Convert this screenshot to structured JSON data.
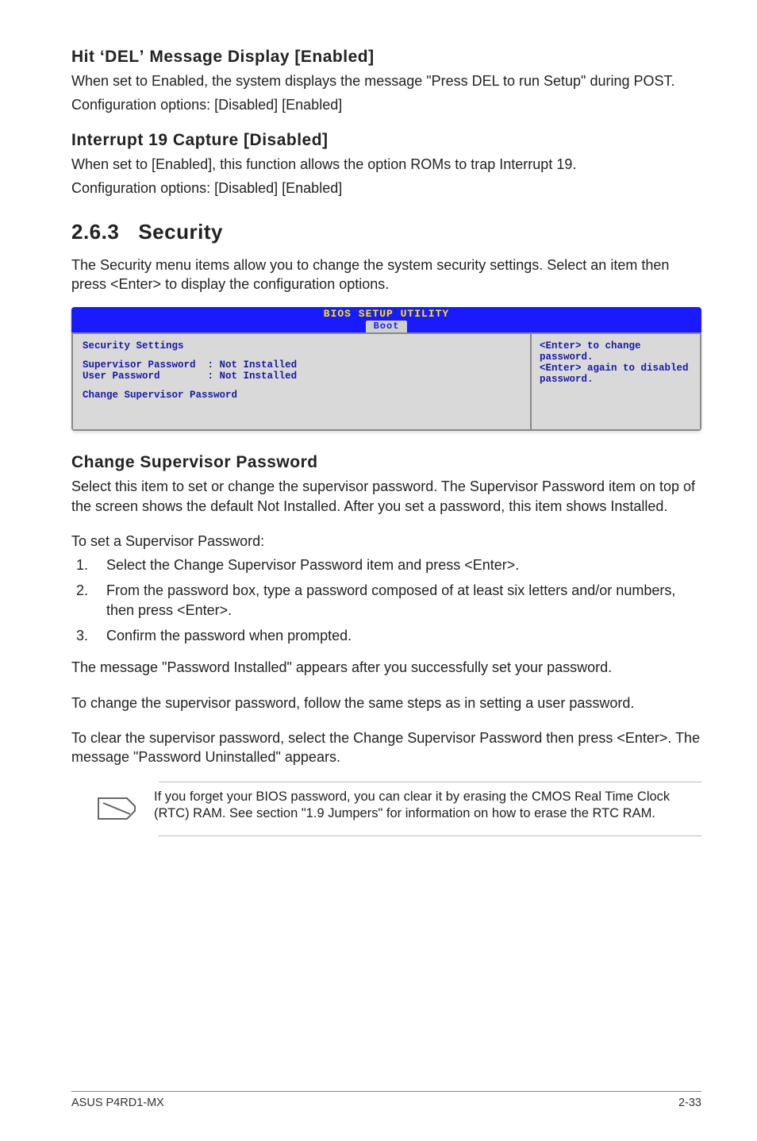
{
  "sec1": {
    "title": "Hit ʻDELʼ Message Display [Enabled]",
    "p1": "When set to Enabled, the system displays the message \"Press DEL to run Setup\" during POST.",
    "p2": "Configuration options: [Disabled] [Enabled]"
  },
  "sec2": {
    "title": "Interrupt 19 Capture [Disabled]",
    "p1": "When set to [Enabled], this function allows the option ROMs to trap Interrupt 19.",
    "p2": "Configuration options: [Disabled] [Enabled]"
  },
  "sec3": {
    "num": "2.6.3",
    "title": "Security",
    "intro": "The Security menu items allow you to change the system security settings. Select an item then press <Enter> to display the configuration options."
  },
  "bios": {
    "header": "BIOS SETUP UTILITY",
    "tab": "Boot",
    "left_title": "Security Settings",
    "row1_label": "Supervisor Password",
    "row1_value": ": Not Installed",
    "row2_label": "User Password",
    "row2_value": ": Not Installed",
    "row3": "Change Supervisor Password",
    "right1": "<Enter> to change password.",
    "right2": "<Enter> again to disabled password."
  },
  "sec4": {
    "title": "Change Supervisor Password",
    "p1": "Select this item to set or change the supervisor password. The Supervisor Password item on top of the screen shows the default Not Installed. After you set a password, this item shows Installed.",
    "p2": "To set a Supervisor Password:",
    "steps": [
      "Select the Change Supervisor Password item and press <Enter>.",
      "From the password box, type a password composed of at least six letters and/or numbers, then press <Enter>.",
      "Confirm the password when prompted."
    ],
    "p3": "The message \"Password Installed\" appears after you successfully set your password.",
    "p4": "To change the supervisor password, follow the same steps as in setting a user password.",
    "p5": "To clear the supervisor password, select the Change Supervisor Password then press <Enter>. The message \"Password Uninstalled\" appears."
  },
  "note": {
    "text": "If you forget your BIOS password, you can clear it by erasing the CMOS Real Time Clock (RTC) RAM. See section \"1.9  Jumpers\" for information on how to erase the RTC RAM."
  },
  "footer": {
    "left": "ASUS P4RD1-MX",
    "right": "2-33"
  }
}
